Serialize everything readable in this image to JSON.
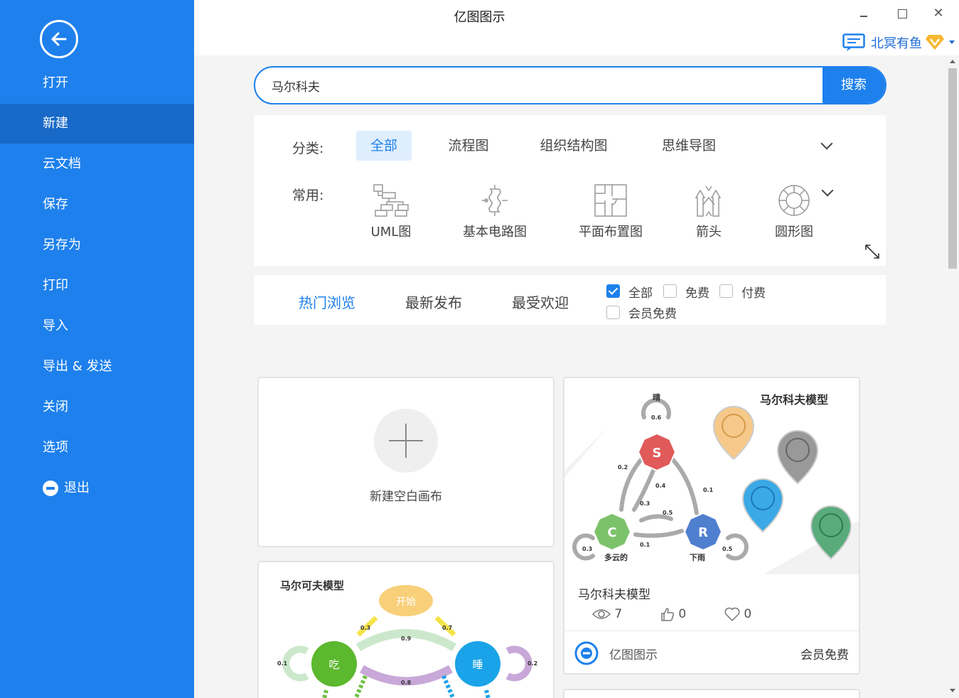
{
  "app": {
    "title": "亿图图示"
  },
  "sidebar": {
    "items": [
      {
        "label": "打开"
      },
      {
        "label": "新建"
      },
      {
        "label": "云文档"
      },
      {
        "label": "保存"
      },
      {
        "label": "另存为"
      },
      {
        "label": "打印"
      },
      {
        "label": "导入"
      },
      {
        "label": "导出 & 发送"
      },
      {
        "label": "关闭"
      },
      {
        "label": "选项"
      },
      {
        "label": "退出"
      }
    ],
    "active_index": 1
  },
  "user": {
    "name": "北冥有鱼"
  },
  "search": {
    "value": "马尔科夫",
    "button": "搜索"
  },
  "categories": {
    "label": "分类:",
    "tabs": [
      "全部",
      "流程图",
      "组织结构图",
      "思维导图"
    ],
    "active_index": 0
  },
  "common": {
    "label": "常用:",
    "items": [
      {
        "label": "UML图",
        "icon": "uml-icon"
      },
      {
        "label": "基本电路图",
        "icon": "circuit-icon"
      },
      {
        "label": "平面布置图",
        "icon": "floor-plan-icon"
      },
      {
        "label": "箭头",
        "icon": "arrow-shapes-icon"
      },
      {
        "label": "圆形图",
        "icon": "circular-diagram-icon"
      }
    ]
  },
  "sort": {
    "tabs": [
      "热门浏览",
      "最新发布",
      "最受欢迎"
    ],
    "active_index": 0,
    "filters": [
      {
        "label": "全部",
        "checked": true
      },
      {
        "label": "免费",
        "checked": false
      },
      {
        "label": "付费",
        "checked": false
      },
      {
        "label": "会员免费",
        "checked": false
      }
    ]
  },
  "new_card": {
    "label": "新建空白画布"
  },
  "template": {
    "thumb_title": "马尔科夫模型",
    "node_labels": {
      "s": "S",
      "c": "C",
      "r": "R",
      "s_name": "晴",
      "c_name": "多云的",
      "r_name": "下雨"
    },
    "edge_values": [
      "0.6",
      "0.2",
      "0.4",
      "0.1",
      "0.3",
      "0.5",
      "0.1",
      "0.3",
      "0.5"
    ],
    "name": "马尔科夫模型",
    "views": "7",
    "likes": "0",
    "favorites": "0",
    "brand": "亿图图示",
    "price": "会员免费"
  },
  "template2": {
    "thumb_title": "马尔可夫模型",
    "start_label": "开始",
    "eat_label": "吃",
    "sleep_label": "睡",
    "edge_values": [
      "0.3",
      "0.7",
      "0.9",
      "0.1",
      "0.2",
      "0.8"
    ]
  },
  "colors": {
    "sidebar": "#1e80ec",
    "sidebar_active": "#1869c8",
    "accent": "#1e80ec"
  }
}
